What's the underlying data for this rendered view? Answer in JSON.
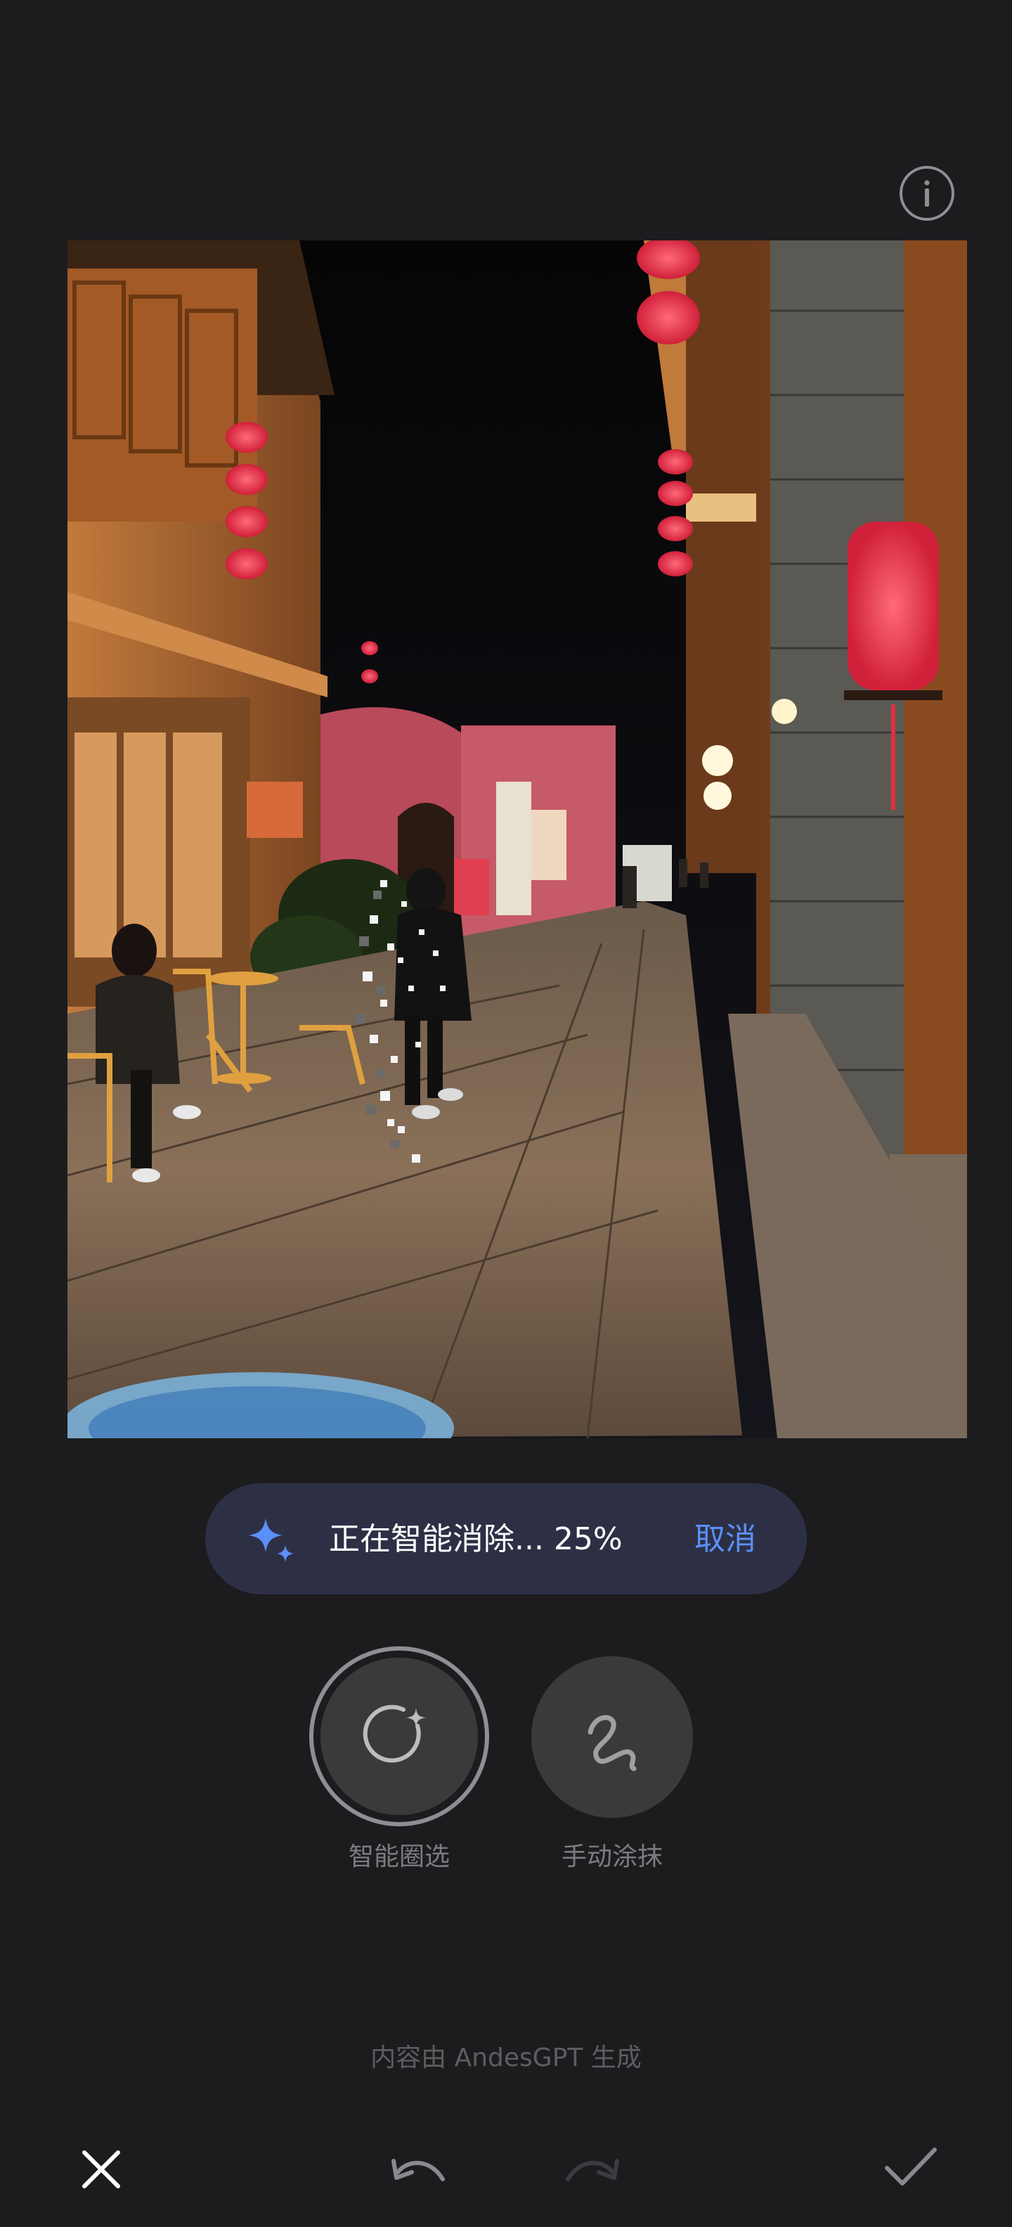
{
  "progress": {
    "text": "正在智能消除... 25%",
    "value": 0.25,
    "cancel_label": "取消"
  },
  "tools": [
    {
      "label": "智能圈选",
      "icon": "smart-select-icon",
      "selected": true
    },
    {
      "label": "手动涂抹",
      "icon": "manual-brush-icon",
      "selected": false
    }
  ],
  "footnote": "内容由 AndesGPT 生成",
  "icons": {
    "info": "info-icon",
    "close": "close-icon",
    "undo": "undo-icon",
    "redo": "redo-icon",
    "confirm": "check-icon",
    "sparkle": "sparkle-icon"
  },
  "colors": {
    "background": "#1c1c1e",
    "pill": "#2d3045",
    "accent": "#5b8ff9",
    "muted_text": "#7c7c80"
  }
}
